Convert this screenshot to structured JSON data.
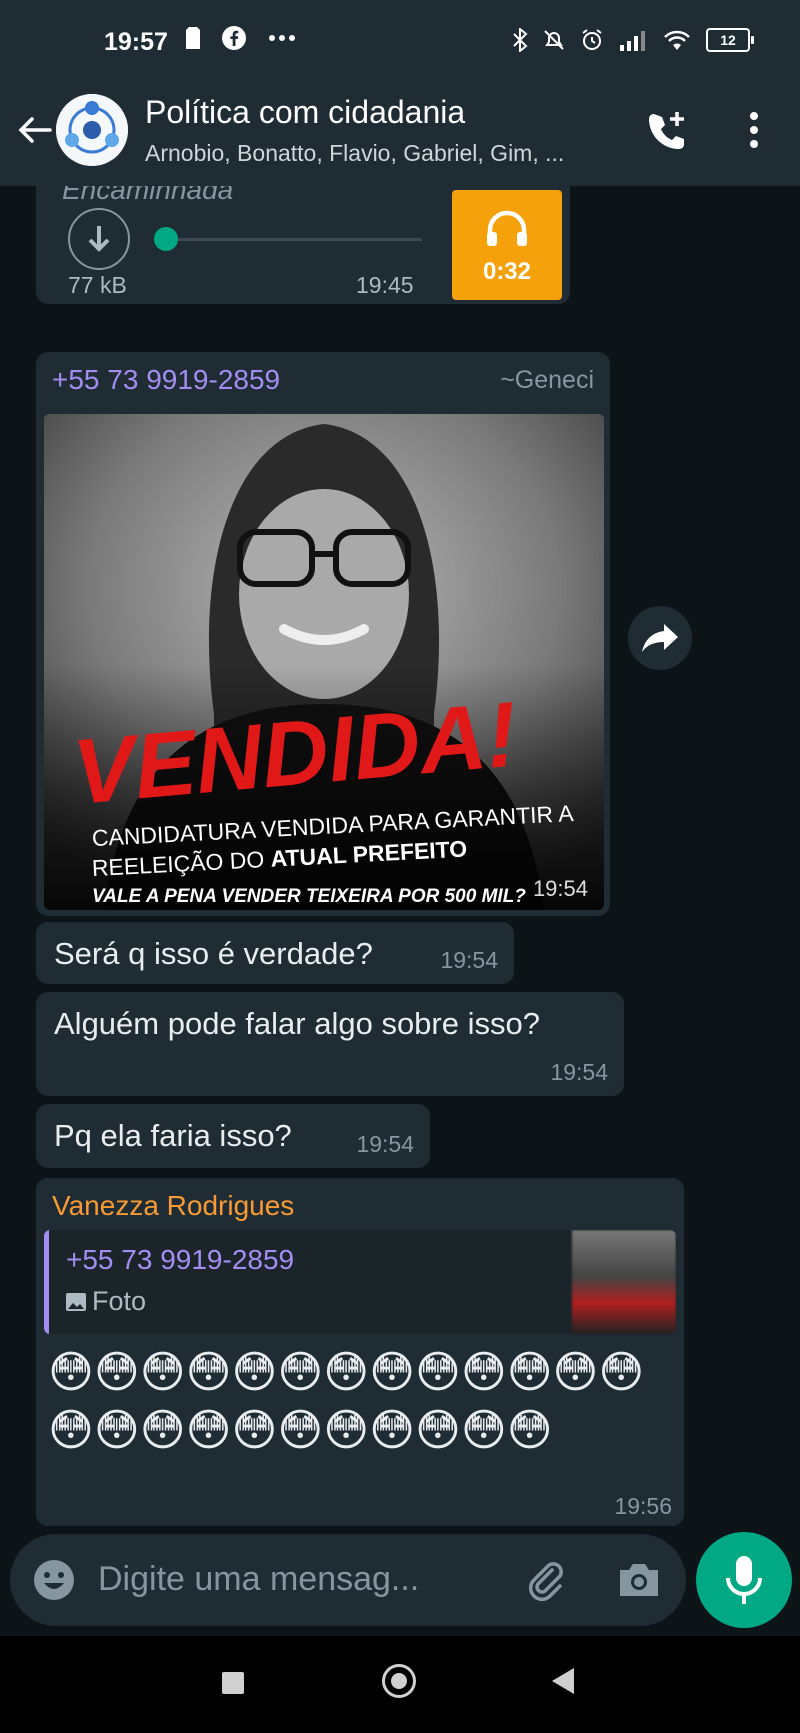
{
  "status_bar": {
    "time": "19:57",
    "left_icons": [
      "sim-card-icon",
      "facebook-icon",
      "more-dots-icon"
    ],
    "right_icons": [
      "bluetooth-icon",
      "mute-icon",
      "alarm-icon",
      "signal-icon",
      "wifi-icon"
    ],
    "battery": "12"
  },
  "header": {
    "title": "Política com cidadania",
    "members": "Arnobio, Bonatto, Flavio, Gabriel, Gim, ..."
  },
  "messages": {
    "audio": {
      "forwarded_label": "Encaminhada",
      "size": "77 kB",
      "time": "19:45",
      "duration": "0:32"
    },
    "image": {
      "sender_phone": "+55 73 9919-2859",
      "push_name": "~Geneci",
      "headline": "VENDIDA!",
      "caption_line1": "CANDIDATURA VENDIDA PARA GARANTIR A",
      "caption_line2_prefix": "REELEIÇÃO DO ",
      "caption_line2_bold": "ATUAL PREFEITO",
      "caption_bottom": "VALE A PENA VENDER TEIXEIRA POR 500 MIL?",
      "time": "19:54"
    },
    "text1": {
      "text": "Será q isso é verdade?",
      "time": "19:54"
    },
    "text2": {
      "text": "Alguém pode falar algo sobre isso?",
      "time": "19:54"
    },
    "text3": {
      "text": "Pq ela faria isso?",
      "time": "19:54"
    },
    "reply": {
      "sender": "Vanezza Rodrigues",
      "quoted_sender": "+55 73 9919-2859",
      "quoted_type": "Foto",
      "emojis": "😳😳😳😳😳😳😳😳😳😳😳😳😳😳😳😳😳😳😳😳😳😳😳😳",
      "time": "19:56"
    }
  },
  "composer": {
    "placeholder": "Digite uma mensag..."
  },
  "colors": {
    "accent": "#00a884",
    "bubble": "#202c33",
    "background": "#0d1418",
    "sender_purple": "#a38df2",
    "sender_orange": "#f79a35"
  }
}
